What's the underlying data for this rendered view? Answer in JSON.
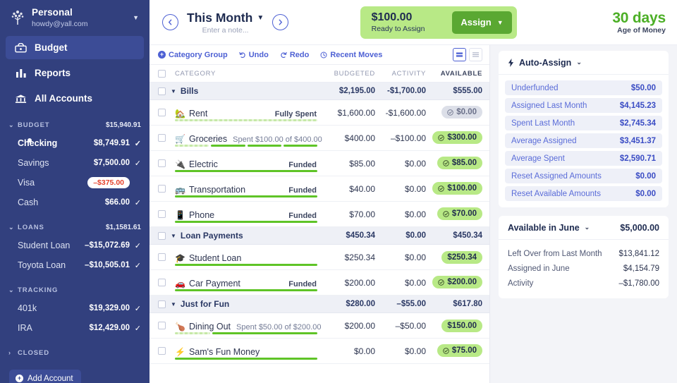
{
  "sidebar": {
    "budget": {
      "name": "Personal",
      "email": "howdy@yall.com",
      "logo_icon": "tree-logo-icon",
      "caret_icon": "caret-down-icon"
    },
    "nav": [
      {
        "label": "Budget",
        "icon": "budget-icon",
        "active": true
      },
      {
        "label": "Reports",
        "icon": "reports-bar-chart-icon",
        "active": false
      },
      {
        "label": "All Accounts",
        "icon": "bank-icon",
        "active": false
      }
    ],
    "groups": [
      {
        "name": "BUDGET",
        "total": "$15,940.91",
        "expanded": true,
        "accounts": [
          {
            "name": "Checking",
            "balance": "$8,749.91",
            "current": true,
            "reconciled": true,
            "negative": false
          },
          {
            "name": "Savings",
            "balance": "$7,500.00",
            "current": false,
            "reconciled": true,
            "negative": false
          },
          {
            "name": "Visa",
            "balance": "–$375.00",
            "current": false,
            "reconciled": false,
            "negative": true
          },
          {
            "name": "Cash",
            "balance": "$66.00",
            "current": false,
            "reconciled": true,
            "negative": false
          }
        ]
      },
      {
        "name": "LOANS",
        "total": "$1,1581.61",
        "expanded": true,
        "accounts": [
          {
            "name": "Student Loan",
            "balance": "–$15,072.69",
            "current": false,
            "reconciled": true,
            "negative": false
          },
          {
            "name": "Toyota Loan",
            "balance": "–$10,505.01",
            "current": false,
            "reconciled": true,
            "negative": false
          }
        ]
      },
      {
        "name": "TRACKING",
        "total": "",
        "expanded": true,
        "accounts": [
          {
            "name": "401k",
            "balance": "$19,329.00",
            "current": false,
            "reconciled": true,
            "negative": false
          },
          {
            "name": "IRA",
            "balance": "$12,429.00",
            "current": false,
            "reconciled": true,
            "negative": false
          }
        ]
      },
      {
        "name": "CLOSED",
        "total": "",
        "expanded": false,
        "accounts": []
      }
    ],
    "add_account_label": "Add Account"
  },
  "topbar": {
    "prev_icon": "chevron-left-circle-icon",
    "next_icon": "chevron-right-circle-icon",
    "month_title": "This Month",
    "month_caret_icon": "caret-down-icon",
    "note_placeholder": "Enter a note...",
    "ready_to_assign": {
      "value": "$100.00",
      "label": "Ready to Assign"
    },
    "assign_button": "Assign",
    "age_of_money": {
      "value": "30 days",
      "label": "Age of Money"
    }
  },
  "toolbar": {
    "category_group": "Category Group",
    "undo": "Undo",
    "redo": "Redo",
    "recent_moves": "Recent Moves",
    "view_compact_icon": "view-compact-icon",
    "view_list_icon": "view-list-icon"
  },
  "table": {
    "columns": {
      "category": "CATEGORY",
      "budgeted": "BUDGETED",
      "activity": "ACTIVITY",
      "available": "AVAILABLE"
    },
    "groups": [
      {
        "name": "Bills",
        "budgeted": "$2,195.00",
        "activity": "-$1,700.00",
        "available": "$555.00",
        "categories": [
          {
            "emoji": "🏡",
            "icon": "house-icon",
            "name": "Rent",
            "goal": "Fully Spent",
            "goal_position": "right",
            "budgeted": "$1,600.00",
            "activity": "-$1,600.00",
            "available": "$0.00",
            "pill": "gray",
            "checked": true,
            "progress": [
              {
                "type": "spent",
                "flex": 100
              }
            ]
          },
          {
            "emoji": "🛒",
            "icon": "grocery-cart-icon",
            "name": "Groceries",
            "goal": "Spent $100.00 of $400.00",
            "goal_position": "inline",
            "budgeted": "$400.00",
            "activity": "–$100.00",
            "available": "$300.00",
            "pill": "green",
            "checked": true,
            "progress": [
              {
                "type": "spent",
                "flex": 25
              },
              {
                "type": "full",
                "flex": 25
              },
              {
                "type": "full",
                "flex": 25
              },
              {
                "type": "full",
                "flex": 25
              }
            ]
          },
          {
            "emoji": "🔌",
            "icon": "plug-icon",
            "name": "Electric",
            "goal": "Funded",
            "goal_position": "right",
            "budgeted": "$85.00",
            "activity": "$0.00",
            "available": "$85.00",
            "pill": "green",
            "checked": true,
            "progress": [
              {
                "type": "full",
                "flex": 100
              }
            ]
          },
          {
            "emoji": "🚌",
            "icon": "bus-icon",
            "name": "Transportation",
            "goal": "Funded",
            "goal_position": "right",
            "budgeted": "$40.00",
            "activity": "$0.00",
            "available": "$100.00",
            "pill": "green",
            "checked": true,
            "progress": [
              {
                "type": "full",
                "flex": 100
              }
            ]
          },
          {
            "emoji": "📱",
            "icon": "phone-icon",
            "name": "Phone",
            "goal": "Funded",
            "goal_position": "right",
            "budgeted": "$70.00",
            "activity": "$0.00",
            "available": "$70.00",
            "pill": "green",
            "checked": true,
            "progress": [
              {
                "type": "full",
                "flex": 100
              }
            ]
          }
        ]
      },
      {
        "name": "Loan Payments",
        "budgeted": "$450.34",
        "activity": "$0.00",
        "available": "$450.34",
        "categories": [
          {
            "emoji": "🎓",
            "icon": "graduation-cap-icon",
            "name": "Student Loan",
            "goal": "",
            "goal_position": "right",
            "budgeted": "$250.34",
            "activity": "$0.00",
            "available": "$250.34",
            "pill": "green",
            "checked": false,
            "progress": [
              {
                "type": "full",
                "flex": 100
              }
            ]
          },
          {
            "emoji": "🚗",
            "icon": "car-icon",
            "name": "Car Payment",
            "goal": "Funded",
            "goal_position": "right",
            "budgeted": "$200.00",
            "activity": "$0.00",
            "available": "$200.00",
            "pill": "green",
            "checked": true,
            "progress": [
              {
                "type": "full",
                "flex": 100
              }
            ]
          }
        ]
      },
      {
        "name": "Just for Fun",
        "budgeted": "$280.00",
        "activity": "–$55.00",
        "available": "$617.80",
        "categories": [
          {
            "emoji": "🍗",
            "icon": "food-icon",
            "name": "Dining Out",
            "goal": "Spent $50.00 of $200.00",
            "goal_position": "inline",
            "budgeted": "$200.00",
            "activity": "–$50.00",
            "available": "$150.00",
            "pill": "green",
            "checked": false,
            "progress": [
              {
                "type": "spent",
                "flex": 25
              },
              {
                "type": "full",
                "flex": 75
              }
            ]
          },
          {
            "emoji": "⚡",
            "icon": "bolt-icon",
            "name": "Sam's Fun Money",
            "goal": "",
            "goal_position": "right",
            "budgeted": "$0.00",
            "activity": "$0.00",
            "available": "$75.00",
            "pill": "green",
            "checked": true,
            "progress": [
              {
                "type": "full",
                "flex": 100
              }
            ]
          }
        ]
      }
    ]
  },
  "right_panel": {
    "auto_assign": {
      "title": "Auto-Assign",
      "bolt_icon": "bolt-icon",
      "chevron_icon": "chevron-down-icon",
      "rows": [
        {
          "label": "Underfunded",
          "amount": "$50.00"
        },
        {
          "label": "Assigned Last Month",
          "amount": "$4,145.23"
        },
        {
          "label": "Spent Last Month",
          "amount": "$2,745.34"
        },
        {
          "label": "Average Assigned",
          "amount": "$3,451.37"
        },
        {
          "label": "Average Spent",
          "amount": "$2,590.71"
        },
        {
          "label": "Reset Assigned Amounts",
          "amount": "$0.00"
        },
        {
          "label": "Reset Available Amounts",
          "amount": "$0.00"
        }
      ]
    },
    "available": {
      "title": "Available in June",
      "chevron_icon": "chevron-down-icon",
      "amount": "$5,000.00",
      "rows": [
        {
          "label": "Left Over from Last Month",
          "amount": "$13,841.12"
        },
        {
          "label": "Assigned in June",
          "amount": "$4,154.79"
        },
        {
          "label": "Activity",
          "amount": "–$1,780.00"
        }
      ]
    }
  },
  "colors": {
    "sidebar_bg": "#32407e",
    "accent_blue": "#4e61d4",
    "green_light": "#b8e986",
    "green_button": "#5aa832",
    "green_aom": "#4caf26",
    "red": "#e5422b"
  }
}
